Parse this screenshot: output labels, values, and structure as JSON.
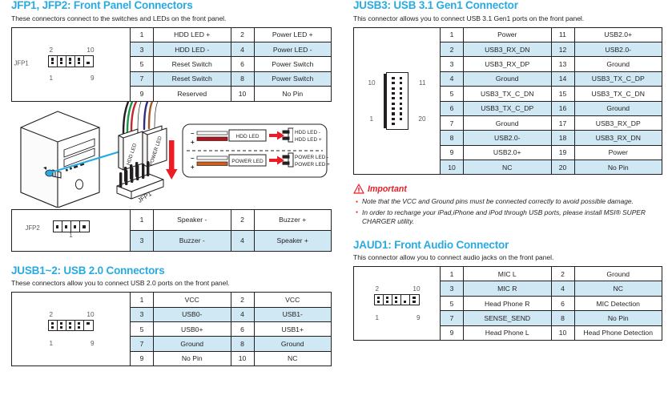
{
  "sections": {
    "jfp": {
      "title": "JFP1, JFP2: Front Panel Connectors",
      "desc": "These connectors connect to the switches and LEDs on the front panel.",
      "jfp1_label": "JFP1",
      "jfp2_label": "JFP2",
      "jfp1_pin_top_left": "2",
      "jfp1_pin_top_right": "10",
      "jfp1_pin_bottom_left": "1",
      "jfp1_pin_bottom_right": "9",
      "jfp2_pin_label": "1",
      "jfp1_rows": [
        {
          "n1": "1",
          "v1": "HDD LED +",
          "n2": "2",
          "v2": "Power LED +",
          "shade": false
        },
        {
          "n1": "3",
          "v1": "HDD LED -",
          "n2": "4",
          "v2": "Power LED -",
          "shade": true
        },
        {
          "n1": "5",
          "v1": "Reset Switch",
          "n2": "6",
          "v2": "Power Switch",
          "shade": false
        },
        {
          "n1": "7",
          "v1": "Reset Switch",
          "n2": "8",
          "v2": "Power Switch",
          "shade": true
        },
        {
          "n1": "9",
          "v1": "Reserved",
          "n2": "10",
          "v2": "No Pin",
          "shade": false
        }
      ],
      "jfp2_rows": [
        {
          "n1": "1",
          "v1": "Speaker -",
          "n2": "2",
          "v2": "Buzzer +",
          "shade": false
        },
        {
          "n1": "3",
          "v1": "Buzzer -",
          "n2": "4",
          "v2": "Speaker +",
          "shade": true
        }
      ]
    },
    "illustration": {
      "connector_hdd_label": "HDD LED",
      "connector_power_label": "POWER LED",
      "header_label": "JFP1",
      "inset": {
        "hdd": {
          "block_label": "HDD LED",
          "minus": "-",
          "plus": "+",
          "target_minus": "HDD LED -",
          "target_plus": "HDD LED +"
        },
        "power": {
          "block_label": "POWER LED",
          "minus": "-",
          "plus": "+",
          "target_minus": "POWER LED -",
          "target_plus": "POWER LED +"
        }
      }
    },
    "jusb12": {
      "title": "JUSB1~2: USB 2.0 Connectors",
      "desc": "These connectors allow you to connect USB 2.0 ports on the front panel.",
      "pin_top_left": "2",
      "pin_top_right": "10",
      "pin_bottom_left": "1",
      "pin_bottom_right": "9",
      "rows": [
        {
          "n1": "1",
          "v1": "VCC",
          "n2": "2",
          "v2": "VCC",
          "shade": false
        },
        {
          "n1": "3",
          "v1": "USB0-",
          "n2": "4",
          "v2": "USB1-",
          "shade": true
        },
        {
          "n1": "5",
          "v1": "USB0+",
          "n2": "6",
          "v2": "USB1+",
          "shade": false
        },
        {
          "n1": "7",
          "v1": "Ground",
          "n2": "8",
          "v2": "Ground",
          "shade": true
        },
        {
          "n1": "9",
          "v1": "No Pin",
          "n2": "10",
          "v2": "NC",
          "shade": false
        }
      ]
    },
    "jusb3": {
      "title": "JUSB3: USB 3.1 Gen1 Connector",
      "desc": "This connector allows you to connect USB 3.1 Gen1 ports on the front panel.",
      "pin_top_left": "10",
      "pin_top_right": "11",
      "pin_bottom_left": "1",
      "pin_bottom_right": "20",
      "rows": [
        {
          "n1": "1",
          "v1": "Power",
          "n2": "11",
          "v2": "USB2.0+",
          "shade": false
        },
        {
          "n1": "2",
          "v1": "USB3_RX_DN",
          "n2": "12",
          "v2": "USB2.0-",
          "shade": true
        },
        {
          "n1": "3",
          "v1": "USB3_RX_DP",
          "n2": "13",
          "v2": "Ground",
          "shade": false
        },
        {
          "n1": "4",
          "v1": "Ground",
          "n2": "14",
          "v2": "USB3_TX_C_DP",
          "shade": true
        },
        {
          "n1": "5",
          "v1": "USB3_TX_C_DN",
          "n2": "15",
          "v2": "USB3_TX_C_DN",
          "shade": false
        },
        {
          "n1": "6",
          "v1": "USB3_TX_C_DP",
          "n2": "16",
          "v2": "Ground",
          "shade": true
        },
        {
          "n1": "7",
          "v1": "Ground",
          "n2": "17",
          "v2": "USB3_RX_DP",
          "shade": false
        },
        {
          "n1": "8",
          "v1": "USB2.0-",
          "n2": "18",
          "v2": "USB3_RX_DN",
          "shade": true
        },
        {
          "n1": "9",
          "v1": "USB2.0+",
          "n2": "19",
          "v2": "Power",
          "shade": false
        },
        {
          "n1": "10",
          "v1": "NC",
          "n2": "20",
          "v2": "No Pin",
          "shade": true
        }
      ]
    },
    "important": {
      "title": "Important",
      "items": [
        "Note that the VCC and Ground pins must be connected correctly to avoid possible damage.",
        "In order to recharge your iPad,iPhone and iPod through USB ports, please install MSI® SUPER CHARGER utility."
      ]
    },
    "jaud1": {
      "title": "JAUD1: Front Audio Connector",
      "desc": "This connector allow you to connect audio jacks on the front panel.",
      "pin_top_left": "2",
      "pin_top_right": "10",
      "pin_bottom_left": "1",
      "pin_bottom_right": "9",
      "rows": [
        {
          "n1": "1",
          "v1": "MIC L",
          "n2": "2",
          "v2": "Ground",
          "shade": false
        },
        {
          "n1": "3",
          "v1": "MIC R",
          "n2": "4",
          "v2": "NC",
          "shade": true
        },
        {
          "n1": "5",
          "v1": "Head Phone R",
          "n2": "6",
          "v2": "MIC Detection",
          "shade": false
        },
        {
          "n1": "7",
          "v1": "SENSE_SEND",
          "n2": "8",
          "v2": "No Pin",
          "shade": true
        },
        {
          "n1": "9",
          "v1": "Head Phone L",
          "n2": "10",
          "v2": "Head Phone Detection",
          "shade": false
        }
      ]
    }
  },
  "colors": {
    "heading_blue": "#29abe2",
    "row_shade": "#cfe8f4",
    "important_red": "#ed1c24",
    "ink": "#231f20"
  }
}
